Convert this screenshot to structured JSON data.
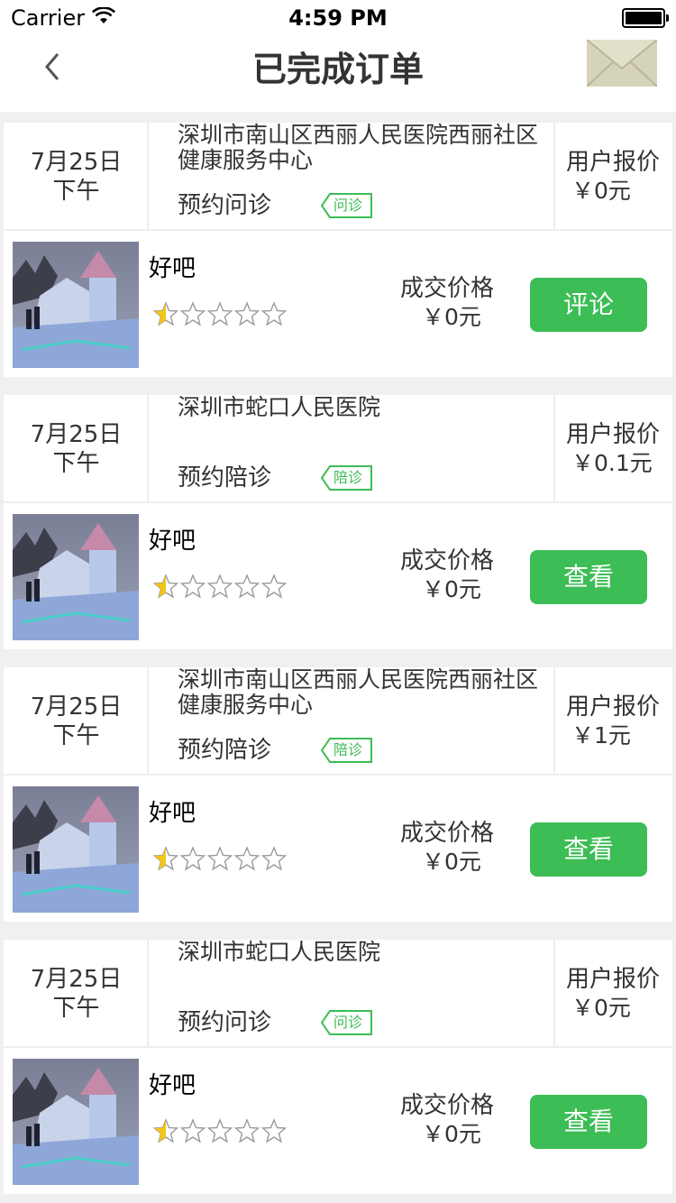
{
  "status_bar": {
    "carrier": "Carrier",
    "time": "4:59 PM"
  },
  "nav": {
    "title": "已完成订单",
    "back_icon": "chevron-left-icon",
    "mail_icon": "envelope-icon"
  },
  "colors": {
    "accent": "#3cbd55",
    "star": "#f5c518"
  },
  "orders": [
    {
      "date": "7月25日",
      "ampm": "下午",
      "hospital": "深圳市南山区西丽人民医院西丽社区健康服务中心",
      "service": "预约问诊",
      "tag": "问诊",
      "quote_label": "用户报价",
      "quote_value": "￥0元",
      "name": "好吧",
      "rating": 0.5,
      "deal_label": "成交价格",
      "deal_value": "￥0元",
      "action": "评论"
    },
    {
      "date": "7月25日",
      "ampm": "下午",
      "hospital": "深圳市蛇口人民医院",
      "service": "预约陪诊",
      "tag": "陪诊",
      "quote_label": "用户报价",
      "quote_value": "￥0.1元",
      "name": "好吧",
      "rating": 0.5,
      "deal_label": "成交价格",
      "deal_value": "￥0元",
      "action": "查看"
    },
    {
      "date": "7月25日",
      "ampm": "下午",
      "hospital": "深圳市南山区西丽人民医院西丽社区健康服务中心",
      "service": "预约陪诊",
      "tag": "陪诊",
      "quote_label": "用户报价",
      "quote_value": "￥1元",
      "name": "好吧",
      "rating": 0.5,
      "deal_label": "成交价格",
      "deal_value": "￥0元",
      "action": "查看"
    },
    {
      "date": "7月25日",
      "ampm": "下午",
      "hospital": "深圳市蛇口人民医院",
      "service": "预约问诊",
      "tag": "问诊",
      "quote_label": "用户报价",
      "quote_value": "￥0元",
      "name": "好吧",
      "rating": 0.5,
      "deal_label": "成交价格",
      "deal_value": "￥0元",
      "action": "查看"
    }
  ]
}
